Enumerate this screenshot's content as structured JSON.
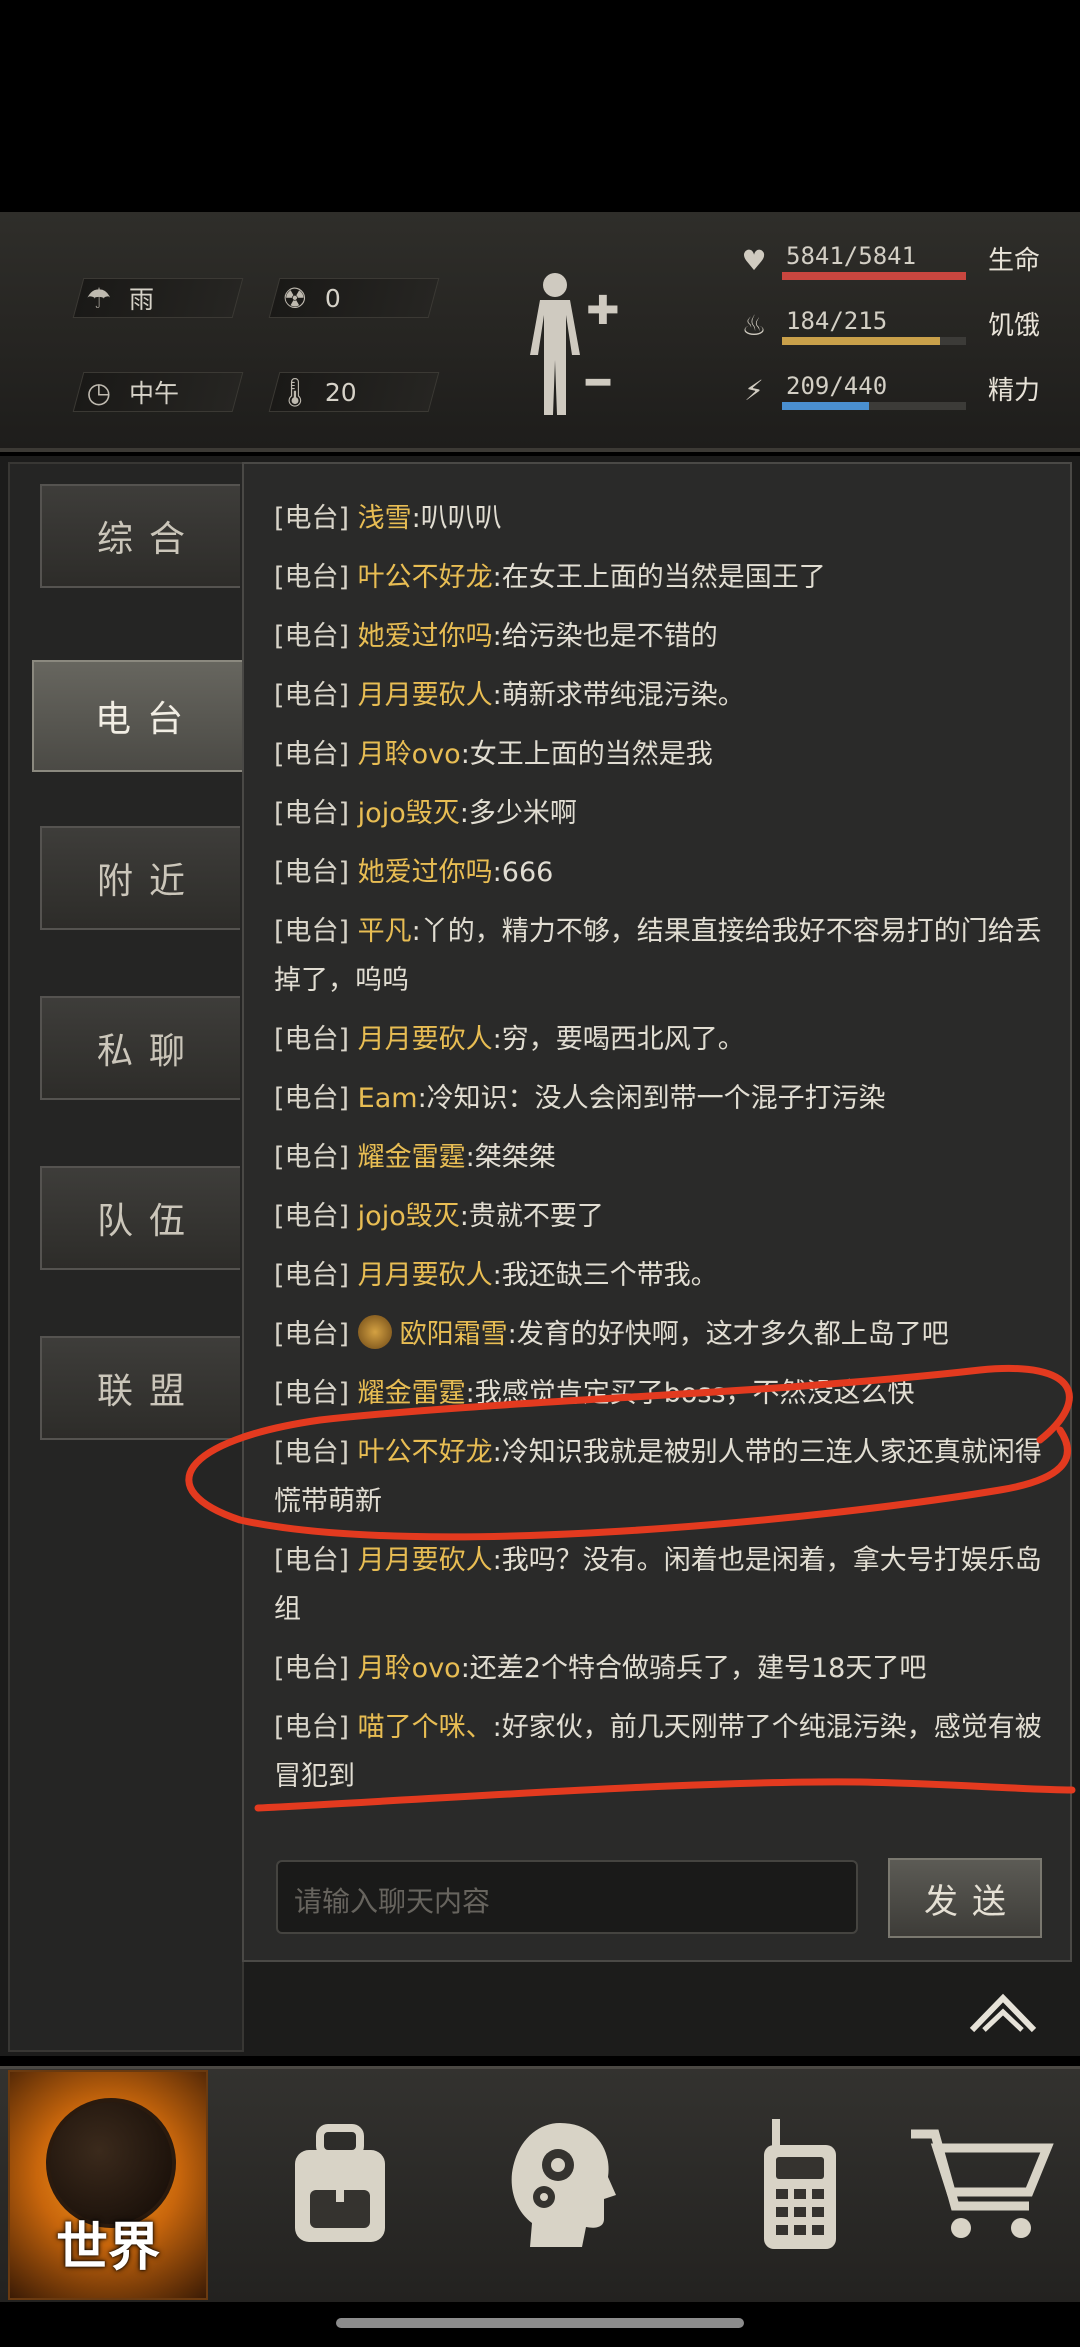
{
  "status": {
    "weather": {
      "icon": "rain-cloud-icon",
      "label": "雨"
    },
    "radiation": {
      "icon": "radiation-icon",
      "value": "0"
    },
    "time": {
      "icon": "clock-icon",
      "label": "中午"
    },
    "temperature": {
      "icon": "thermometer-icon",
      "value": "20"
    },
    "vitals": [
      {
        "icon": "heart-icon",
        "value": "5841/5841",
        "label": "生命",
        "ratio": 1.0,
        "color": "#c9463f"
      },
      {
        "icon": "stomach-icon",
        "value": "184/215",
        "label": "饥饿",
        "ratio": 0.856,
        "color": "#c9a04a"
      },
      {
        "icon": "energy-head-icon",
        "value": "209/440",
        "label": "精力",
        "ratio": 0.475,
        "color": "#4a8fd0"
      }
    ]
  },
  "tabs": [
    {
      "label": "综合",
      "active": false
    },
    {
      "label": "电台",
      "active": true
    },
    {
      "label": "附近",
      "active": false
    },
    {
      "label": "私聊",
      "active": false
    },
    {
      "label": "队伍",
      "active": false
    },
    {
      "label": "联盟",
      "active": false
    }
  ],
  "messages": [
    {
      "channel": "[电台]",
      "name": "浅雪",
      "text": ":叭叭叭"
    },
    {
      "channel": "[电台]",
      "name": "叶公不好龙",
      "text": ":在女王上面的当然是国王了"
    },
    {
      "channel": "[电台]",
      "name": "她爱过你吗",
      "text": ":给污染也是不错的"
    },
    {
      "channel": "[电台]",
      "name": "月月要砍人",
      "text": ":萌新求带纯混污染。"
    },
    {
      "channel": "[电台]",
      "name": "月聆ovo",
      "text": ":女王上面的当然是我"
    },
    {
      "channel": "[电台]",
      "name": "jojo毁灭",
      "text": ":多少米啊"
    },
    {
      "channel": "[电台]",
      "name": "她爱过你吗",
      "text": ":666"
    },
    {
      "channel": "[电台]",
      "name": "平凡",
      "text": ":丫的，精力不够，结果直接给我好不容易打的门给丢掉了，呜呜"
    },
    {
      "channel": "[电台]",
      "name": "月月要砍人",
      "text": ":穷，要喝西北风了。"
    },
    {
      "channel": "[电台]",
      "name": "Eam",
      "text": ":冷知识：没人会闲到带一个混子打污染"
    },
    {
      "channel": "[电台]",
      "name": "耀金雷霆",
      "text": ":桀桀桀"
    },
    {
      "channel": "[电台]",
      "name": "jojo毁灭",
      "text": ":贵就不要了"
    },
    {
      "channel": "[电台]",
      "name": "月月要砍人",
      "text": ":我还缺三个带我。"
    },
    {
      "channel": "[电台]",
      "name": "欧阳霜雪",
      "text": ":发育的好快啊，这才多久都上岛了吧",
      "badge": true
    },
    {
      "channel": "[电台]",
      "name": "耀金雷霆",
      "text": ":我感觉肯定买了boss，不然没这么快"
    },
    {
      "channel": "[电台]",
      "name": "叶公不好龙",
      "text": ":冷知识我就是被别人带的三连人家还真就闲得慌带萌新"
    },
    {
      "channel": "[电台]",
      "name": "月月要砍人",
      "text": ":我吗？没有。闲着也是闲着，拿大号打娱乐岛组"
    },
    {
      "channel": "[电台]",
      "name": "月聆ovo",
      "text": ":还差2个特合做骑兵了，建号18天了吧"
    },
    {
      "channel": "[电台]",
      "name": "喵了个咪、",
      "text": ":好家伙，前几天刚带了个纯混污染，感觉有被冒犯到"
    }
  ],
  "input": {
    "placeholder": "请输入聊天内容",
    "send_label": "发送"
  },
  "nav": [
    {
      "icon": "globe-icon",
      "label": "世界",
      "active": true
    },
    {
      "icon": "backpack-icon"
    },
    {
      "icon": "head-gears-icon"
    },
    {
      "icon": "walkie-talkie-icon"
    },
    {
      "icon": "shopping-cart-icon"
    }
  ]
}
